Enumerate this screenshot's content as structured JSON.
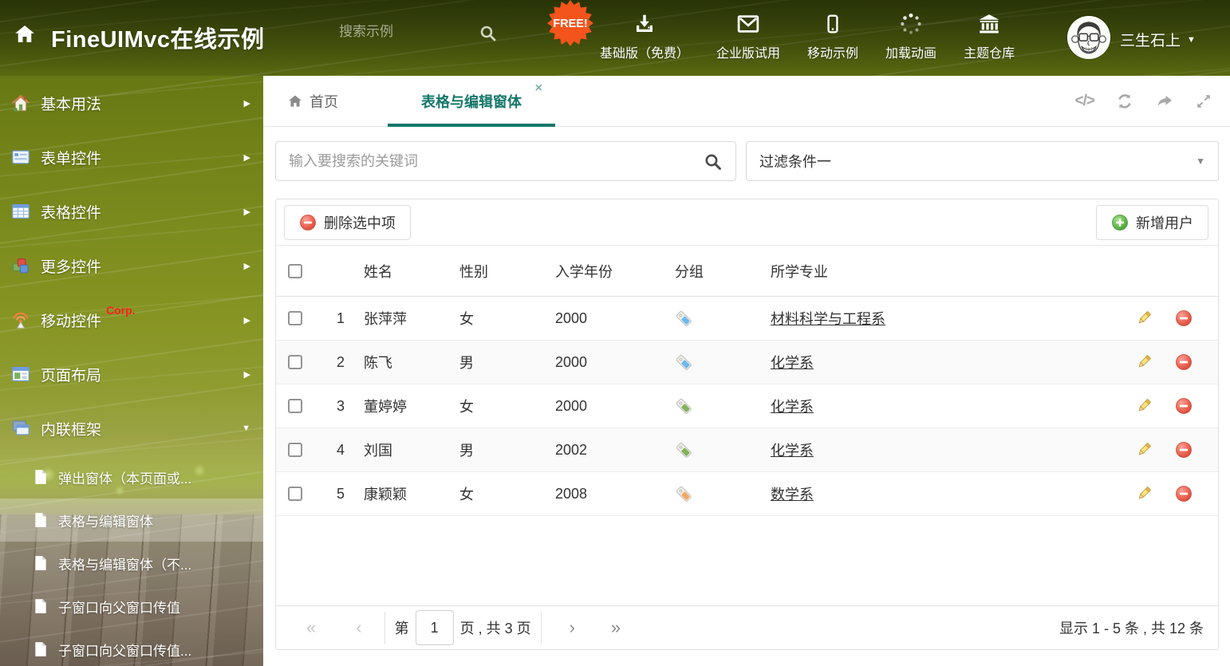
{
  "header": {
    "title": "FineUIMvc在线示例",
    "search_placeholder": "搜索示例",
    "free_badge": "FREE!",
    "nav": [
      {
        "label": "基础版（免费）",
        "icon": "download-icon"
      },
      {
        "label": "企业版试用",
        "icon": "envelope-icon"
      },
      {
        "label": "移动示例",
        "icon": "mobile-icon"
      },
      {
        "label": "加载动画",
        "icon": "spinner-icon"
      },
      {
        "label": "主题仓库",
        "icon": "bank-icon"
      }
    ],
    "username": "三生石上"
  },
  "sidebar": {
    "items": [
      {
        "label": "基本用法",
        "icon": "home-icon"
      },
      {
        "label": "表单控件",
        "icon": "form-icon"
      },
      {
        "label": "表格控件",
        "icon": "table-icon"
      },
      {
        "label": "更多控件",
        "icon": "cubes-icon"
      },
      {
        "label": "移动控件",
        "badge": "Corp.",
        "icon": "antenna-icon"
      },
      {
        "label": "页面布局",
        "icon": "layout-icon"
      },
      {
        "label": "内联框架",
        "icon": "frames-icon"
      }
    ],
    "subitems": [
      {
        "label": "弹出窗体（本页面或..."
      },
      {
        "label": "表格与编辑窗体"
      },
      {
        "label": "表格与编辑窗体（不..."
      },
      {
        "label": "子窗口向父窗口传值"
      },
      {
        "label": "子窗口向父窗口传值..."
      }
    ]
  },
  "tabs": {
    "home_label": "首页",
    "active_label": "表格与编辑窗体"
  },
  "search": {
    "placeholder": "输入要搜索的关键词"
  },
  "filter": {
    "value": "过滤条件一"
  },
  "toolbar": {
    "delete_label": "删除选中项",
    "add_label": "新增用户"
  },
  "table": {
    "headers": {
      "name": "姓名",
      "gender": "性别",
      "year": "入学年份",
      "group": "分组",
      "major": "所学专业"
    },
    "rows": [
      {
        "num": "1",
        "name": "张萍萍",
        "gender": "女",
        "year": "2000",
        "tag_color": "#6cb8ee",
        "major": "材料科学与工程系"
      },
      {
        "num": "2",
        "name": "陈飞",
        "gender": "男",
        "year": "2000",
        "tag_color": "#6cb8ee",
        "major": "化学系"
      },
      {
        "num": "3",
        "name": "董婷婷",
        "gender": "女",
        "year": "2000",
        "tag_color": "#82b15a",
        "major": "化学系"
      },
      {
        "num": "4",
        "name": "刘国",
        "gender": "男",
        "year": "2002",
        "tag_color": "#82b15a",
        "major": "化学系"
      },
      {
        "num": "5",
        "name": "康颖颖",
        "gender": "女",
        "year": "2008",
        "tag_color": "#f5a963",
        "major": "数学系"
      }
    ]
  },
  "pagination": {
    "page_prefix": "第",
    "page_value": "1",
    "page_suffix": "页 , 共 3 页",
    "summary": "显示 1 - 5 条 , 共 12 条"
  },
  "icons": {
    "close": "×",
    "code": "</>",
    "first": "«",
    "prev": "‹",
    "next": "›",
    "last": "»",
    "caret_down": "▼",
    "arrow_right": "▶",
    "arrow_down": "▼"
  },
  "colors": {
    "accent": "#15776a",
    "delete_red": "#e0503f",
    "add_green": "#55b246"
  }
}
